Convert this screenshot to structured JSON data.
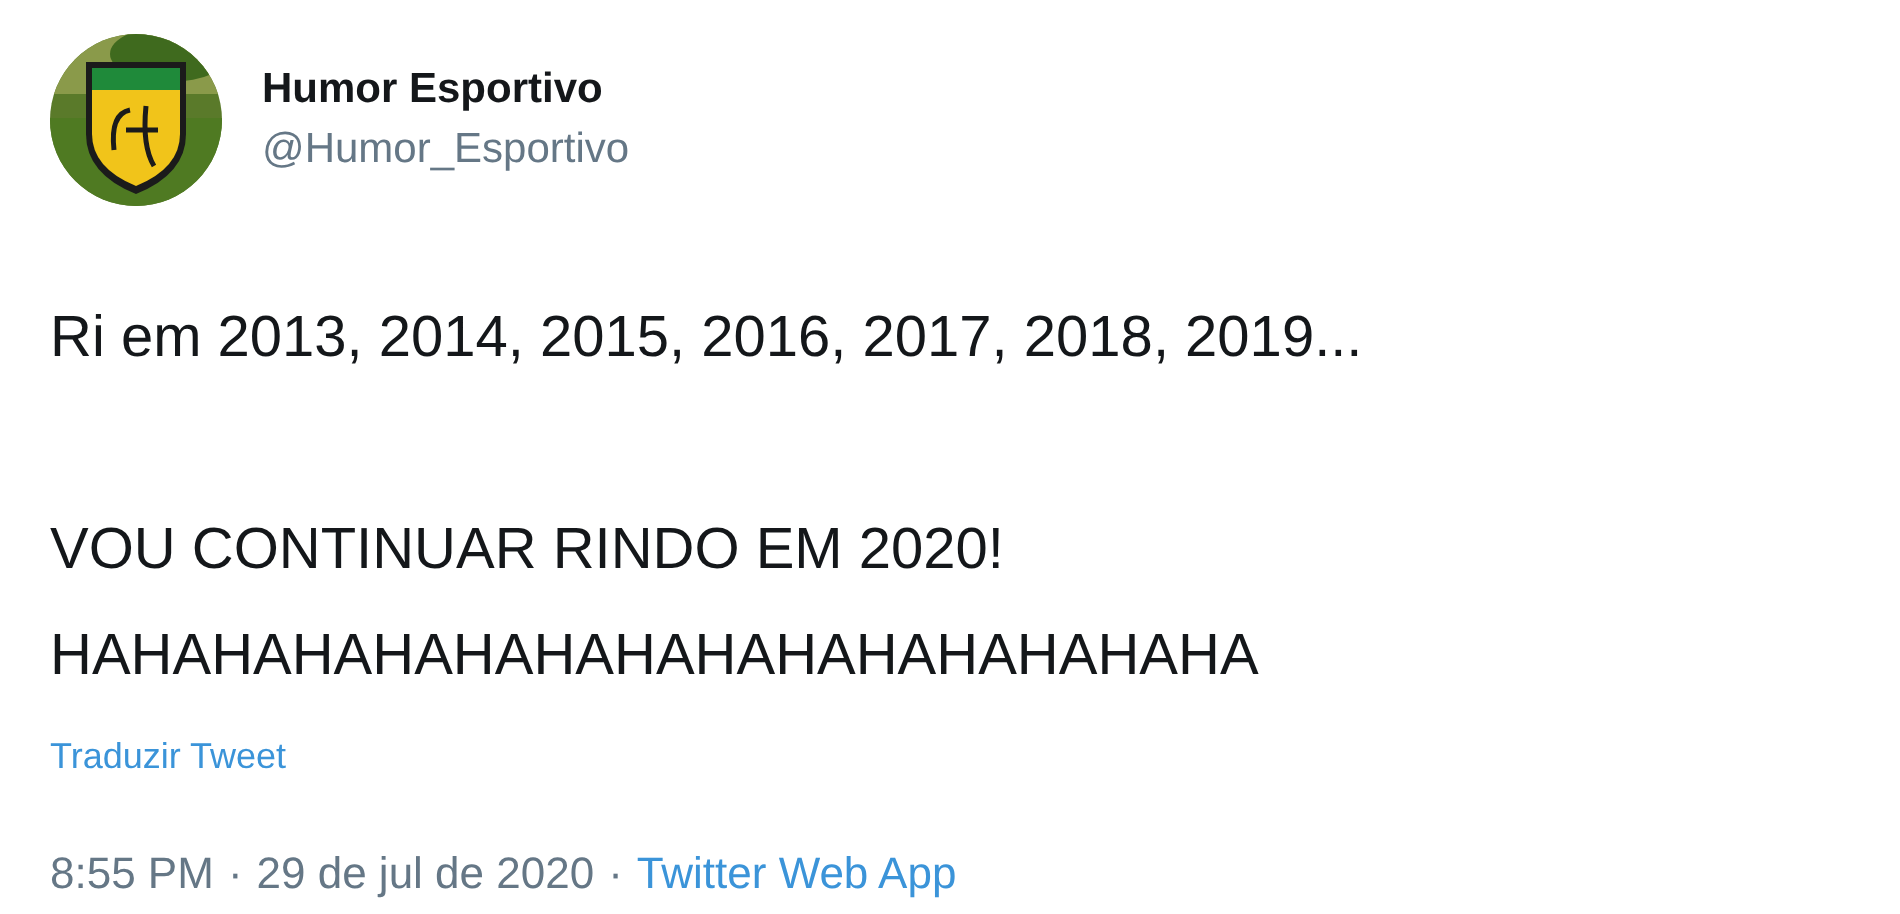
{
  "author": {
    "name": "Humor Esportivo",
    "handle": "@Humor_Esportivo"
  },
  "tweet": {
    "text": "Ri em 2013, 2014, 2015, 2016, 2017, 2018, 2019...\n\nVOU CONTINUAR RINDO EM 2020!\nHAHAHAHAHAHAHAHAHAHAHAHAHAHAHA"
  },
  "translate_link": "Traduzir Tweet",
  "footer": [
    {
      "kind": "text",
      "text": "8:55 PM"
    },
    {
      "kind": "separator",
      "text": "·"
    },
    {
      "kind": "text",
      "text": "29 de jul de 2020"
    },
    {
      "kind": "separator",
      "text": "·"
    },
    {
      "kind": "link",
      "text": "Twitter Web App"
    }
  ]
}
